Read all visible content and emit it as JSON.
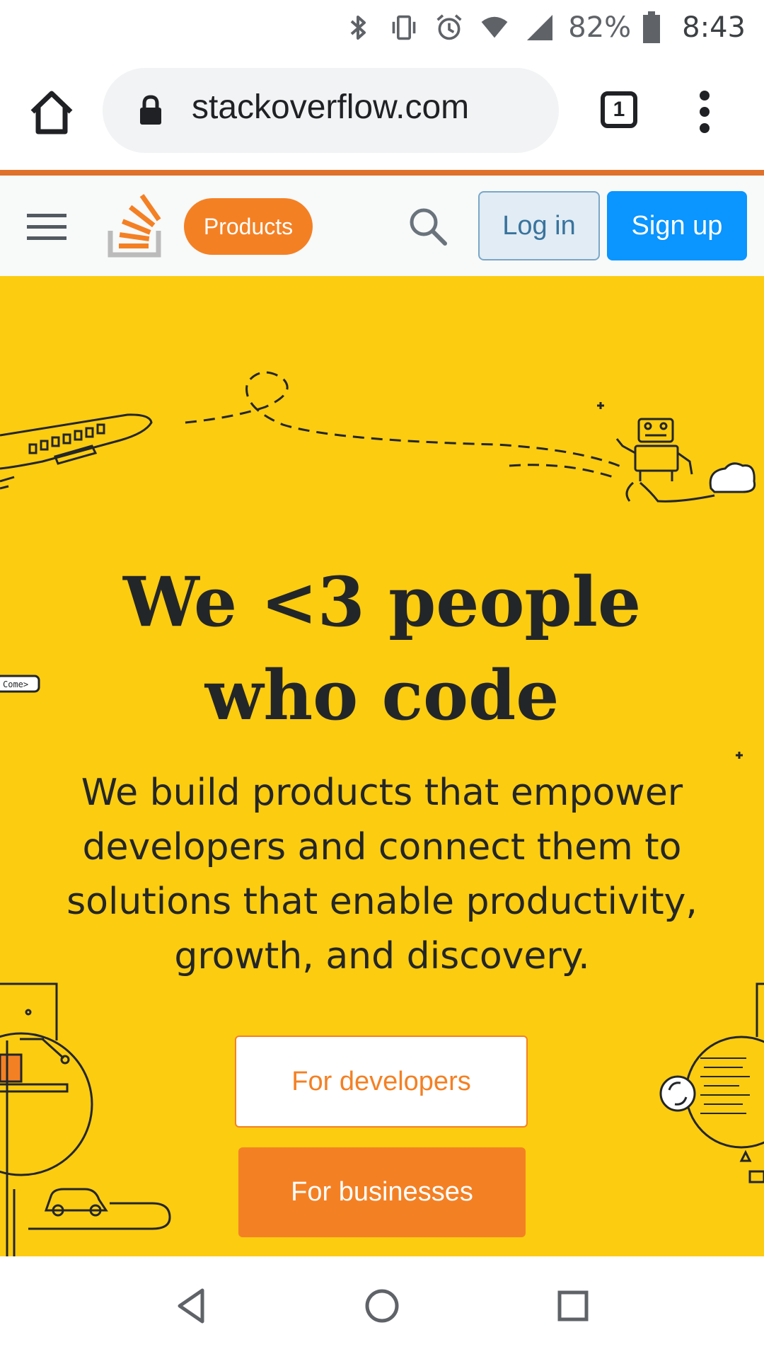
{
  "status_bar": {
    "battery_percent": "82%",
    "time": "8:43",
    "icons": [
      "bluetooth-icon",
      "vibrate-icon",
      "alarm-icon",
      "wifi-icon",
      "signal-icon",
      "battery-icon"
    ]
  },
  "browser": {
    "url": "stackoverflow.com",
    "tab_count": "1",
    "icons": [
      "home-icon",
      "lock-icon",
      "more-menu-icon"
    ]
  },
  "header": {
    "products_label": "Products",
    "login_label": "Log in",
    "signup_label": "Sign up",
    "icons": [
      "hamburger-menu-icon",
      "stackoverflow-logo",
      "search-icon"
    ]
  },
  "hero": {
    "title": "We <3 people who code",
    "subtitle": "We build products that empower developers and connect them to solutions that enable productivity, growth, and discovery.",
    "developers_button": "For developers",
    "businesses_button": "For businesses",
    "illustration_tag": "Come>"
  },
  "nav_bar": {
    "icons": [
      "back-icon",
      "home-circle-icon",
      "recents-icon"
    ]
  },
  "colors": {
    "hero_bg": "#fccc10",
    "brand_orange": "#f48024",
    "signup_blue": "#0a95ff",
    "login_bg": "#e1ecf4",
    "text_dark": "#232629"
  }
}
